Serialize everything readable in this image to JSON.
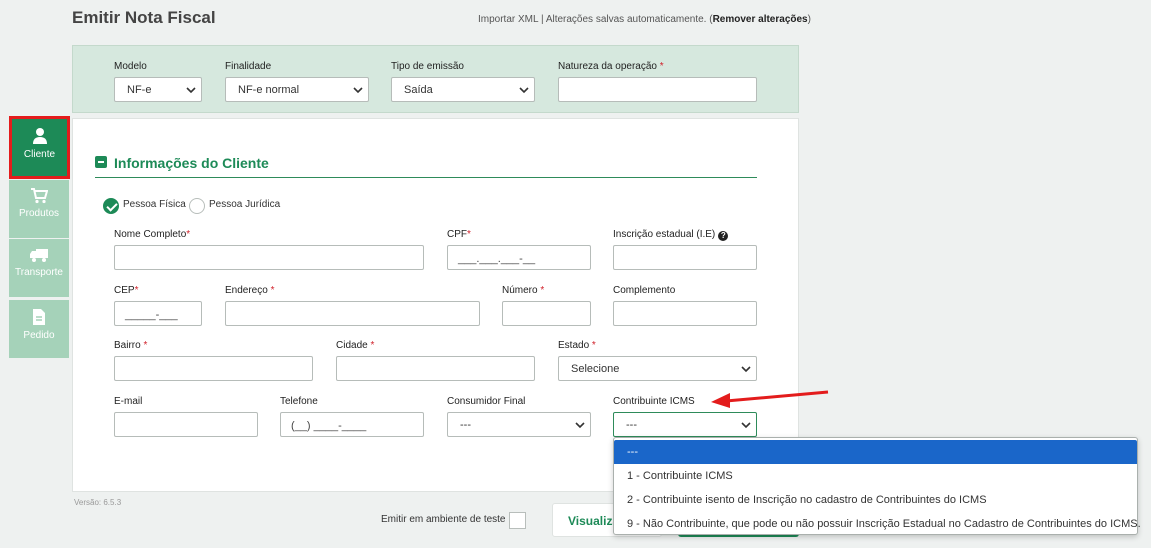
{
  "header": {
    "title": "Emitir Nota Fiscal",
    "import_xml": "Importar XML",
    "separator": " | ",
    "autosave": "Alterações salvas automaticamente. (",
    "remove": "Remover alterações",
    "close_paren": ")"
  },
  "top_panel": {
    "modelo": {
      "label": "Modelo",
      "value": "NF-e"
    },
    "finalidade": {
      "label": "Finalidade",
      "value": "NF-e normal"
    },
    "tipo_emissao": {
      "label": "Tipo de emissão",
      "value": "Saída"
    },
    "natureza": {
      "label": "Natureza da operação",
      "value": ""
    }
  },
  "sidebar": {
    "items": [
      {
        "label": "Cliente",
        "icon": "user-icon",
        "active": true
      },
      {
        "label": "Produtos",
        "icon": "cart-icon",
        "active": false
      },
      {
        "label": "Transporte",
        "icon": "truck-icon",
        "active": false
      },
      {
        "label": "Pedido",
        "icon": "document-icon",
        "active": false
      }
    ]
  },
  "section": {
    "title": "Informações do Cliente"
  },
  "person_type": {
    "fisica": "Pessoa Física",
    "juridica": "Pessoa Jurídica",
    "selected": "fisica"
  },
  "form": {
    "nome": {
      "label": "Nome Completo",
      "value": ""
    },
    "cpf": {
      "label": "CPF",
      "placeholder": "___.___.___-__"
    },
    "ie": {
      "label": "Inscrição estadual (I.E)",
      "value": ""
    },
    "cep": {
      "label": "CEP",
      "placeholder": "_____-___"
    },
    "endereco": {
      "label": "Endereço",
      "value": ""
    },
    "numero": {
      "label": "Número",
      "value": ""
    },
    "complemento": {
      "label": "Complemento",
      "value": ""
    },
    "bairro": {
      "label": "Bairro",
      "value": ""
    },
    "cidade": {
      "label": "Cidade",
      "value": ""
    },
    "estado": {
      "label": "Estado",
      "value": "Selecione"
    },
    "email": {
      "label": "E-mail",
      "value": ""
    },
    "telefone": {
      "label": "Telefone",
      "placeholder": "(__) ____-____"
    },
    "consumidor_final": {
      "label": "Consumidor Final",
      "value": "---"
    },
    "contribuinte_icms": {
      "label": "Contribuinte ICMS",
      "value": "---"
    }
  },
  "dropdown": {
    "options": [
      "---",
      "1 - Contribuinte ICMS",
      "2 - Contribuinte isento de Inscrição no cadastro de Contribuintes do ICMS",
      "9 - Não Contribuinte, que pode ou não possuir Inscrição Estadual no Cadastro de Contribuintes do ICMS."
    ],
    "selected_index": 0
  },
  "footer": {
    "version": "Versão: 6.5.3",
    "test_env": "Emitir em ambiente de teste",
    "visualizar": "Visualizar"
  },
  "colors": {
    "brand_green": "#1d8a57",
    "highlight_red": "#e31c1c",
    "select_blue": "#1a66c9"
  }
}
